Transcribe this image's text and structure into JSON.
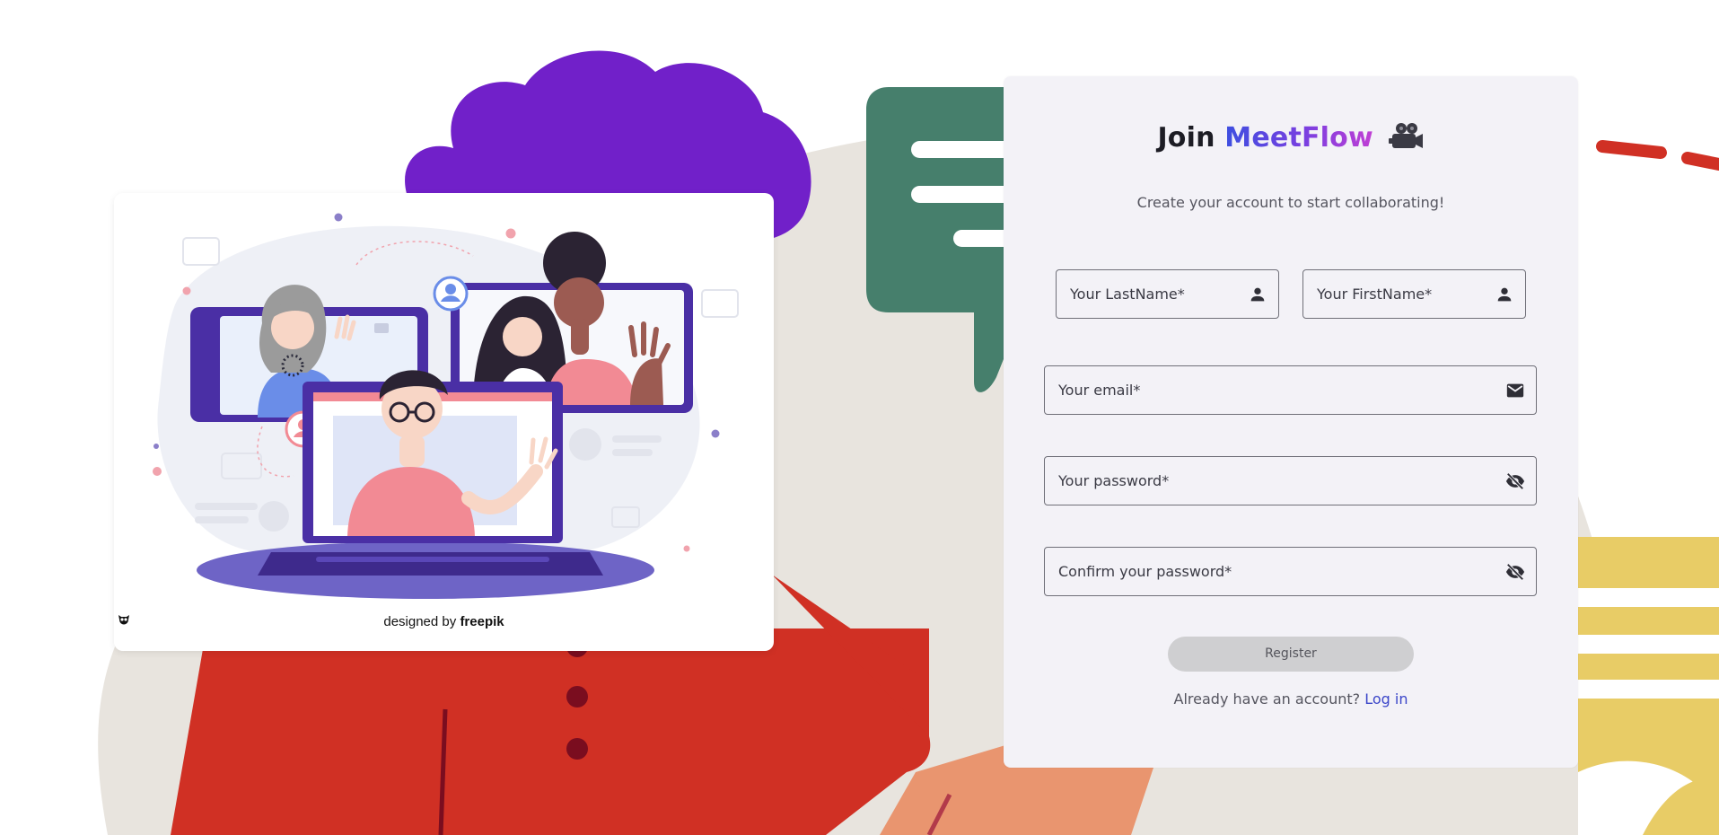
{
  "illustration": {
    "credit_prefix": "designed by",
    "credit_brand": "freepik"
  },
  "register": {
    "title_prefix": "Join ",
    "title_brand": "MeetFlow",
    "subtitle": "Create your account to start collaborating!",
    "lastname_placeholder": "Your LastName*",
    "firstname_placeholder": "Your FirstName*",
    "email_placeholder": "Your email*",
    "password_placeholder": "Your password*",
    "confirm_placeholder": "Confirm your password*",
    "register_label": "Register",
    "login_prompt": "Already have an account?",
    "login_link": "Log in"
  },
  "icons": {
    "title": "movie-camera-icon",
    "lastname": "person-icon",
    "firstname": "person-icon",
    "email": "envelope-icon",
    "password": "eye-off-icon",
    "confirm": "eye-off-icon"
  },
  "colors": {
    "brand_gradient_start": "#3d4fe0",
    "brand_gradient_end": "#c03fd4",
    "login_link": "#3b46c9",
    "register_disabled_bg": "#cfcfd1",
    "panel_bg": "#f3f2f7"
  }
}
